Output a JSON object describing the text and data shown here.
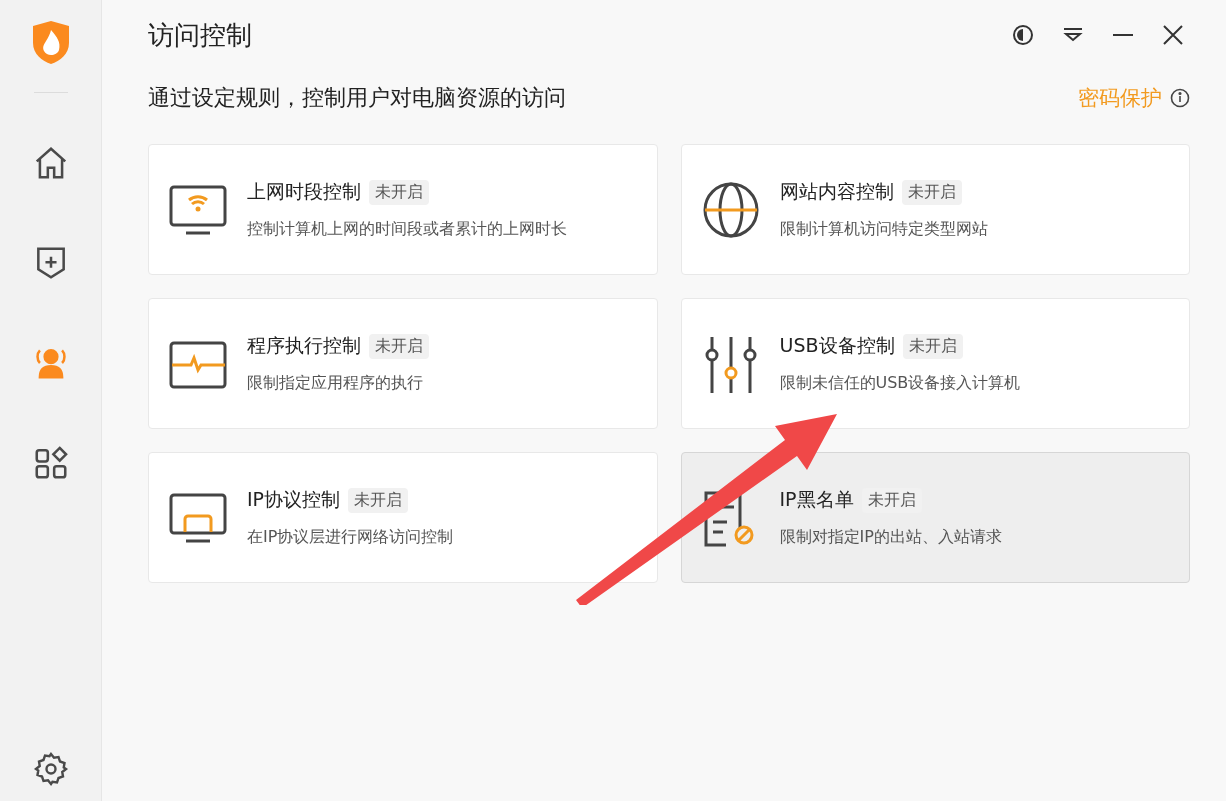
{
  "sidebar": {
    "items": [
      {
        "kind": "home",
        "selected": false
      },
      {
        "kind": "shield",
        "selected": false
      },
      {
        "kind": "users",
        "selected": true
      },
      {
        "kind": "apps",
        "selected": false
      }
    ]
  },
  "window": {
    "title": "访问控制"
  },
  "header": {
    "subtitle": "通过设定规则，控制用户对电脑资源的访问",
    "link": "密码保护"
  },
  "cards": [
    {
      "kind": "wifi",
      "title": "上网时段控制",
      "status": "未开启",
      "description": "控制计算机上网的时间段或者累计的上网时长",
      "highlighted": false
    },
    {
      "kind": "globe",
      "title": "网站内容控制",
      "status": "未开启",
      "description": "限制计算机访问特定类型网站",
      "highlighted": false
    },
    {
      "kind": "pulse",
      "title": "程序执行控制",
      "status": "未开启",
      "description": "限制指定应用程序的执行",
      "highlighted": false
    },
    {
      "kind": "sliders",
      "title": "USB设备控制",
      "status": "未开启",
      "description": "限制未信任的USB设备接入计算机",
      "highlighted": false
    },
    {
      "kind": "monitor",
      "title": "IP协议控制",
      "status": "未开启",
      "description": "在IP协议层进行网络访问控制",
      "highlighted": false
    },
    {
      "kind": "blocklist",
      "title": "IP黑名单",
      "status": "未开启",
      "description": "限制对指定IP的出站、入站请求",
      "highlighted": true
    }
  ]
}
